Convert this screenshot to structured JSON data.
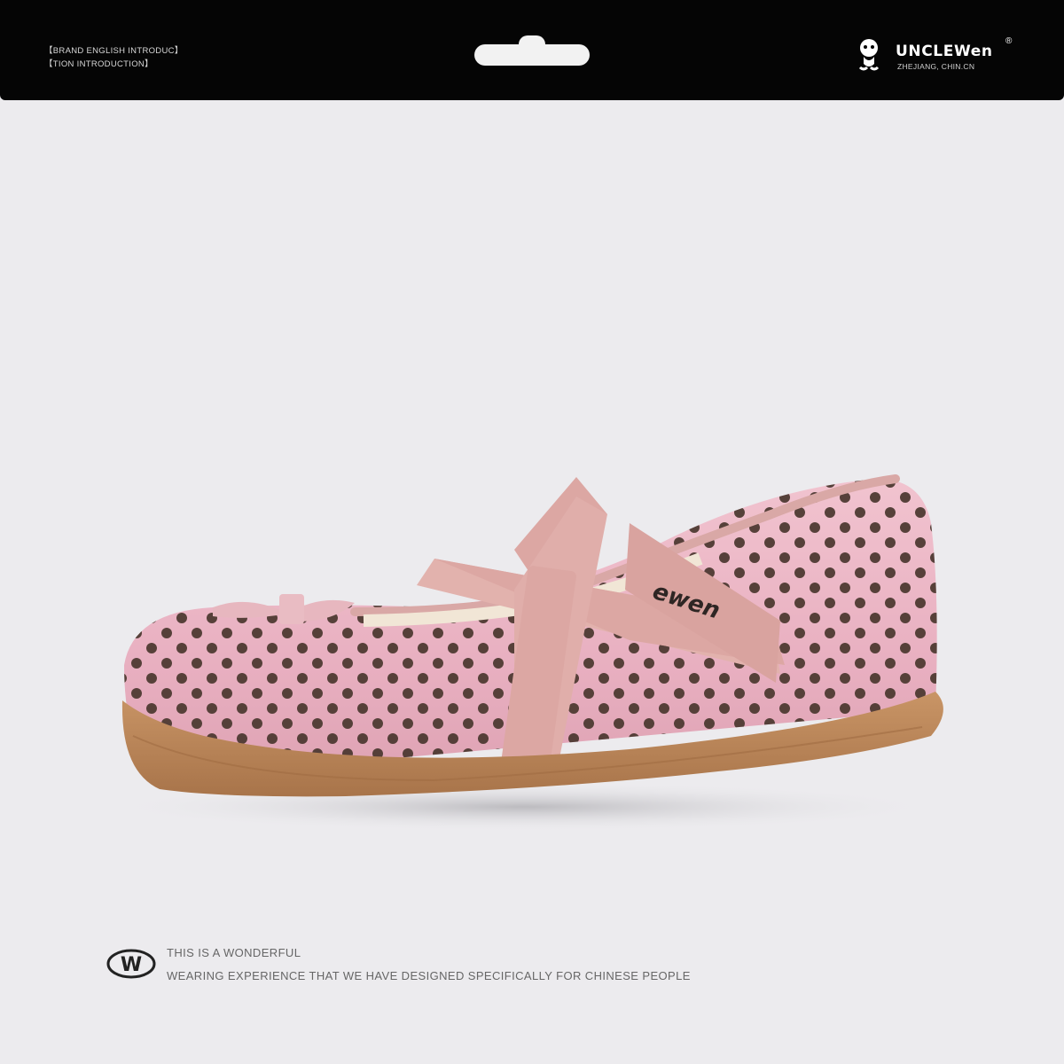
{
  "header": {
    "intro_line_1": "【BRAND ENGLISH INTRODUC】",
    "intro_line_2": "【TION INTRODUCTION】",
    "brand_name": "UNCLEWen",
    "brand_registered_mark": "®",
    "brand_location": "ZHEJIANG, CHIN.CN"
  },
  "product": {
    "icon": "polka-dot-mary-jane-shoe",
    "strap_logo_text": "ewen"
  },
  "footer": {
    "logo_letter": "W",
    "line_1": "THIS IS A WONDERFUL",
    "line_2": "WEARING EXPERIENCE THAT WE HAVE DESIGNED SPECIFICALLY FOR CHINESE PEOPLE"
  },
  "colors": {
    "header_bg": "#050505",
    "page_bg": "#ecebee",
    "shoe_pink": "#eab6c4",
    "dot_brown": "#4e3a32",
    "sole_tan": "#b98655",
    "strap_pink": "#dca7a3"
  }
}
